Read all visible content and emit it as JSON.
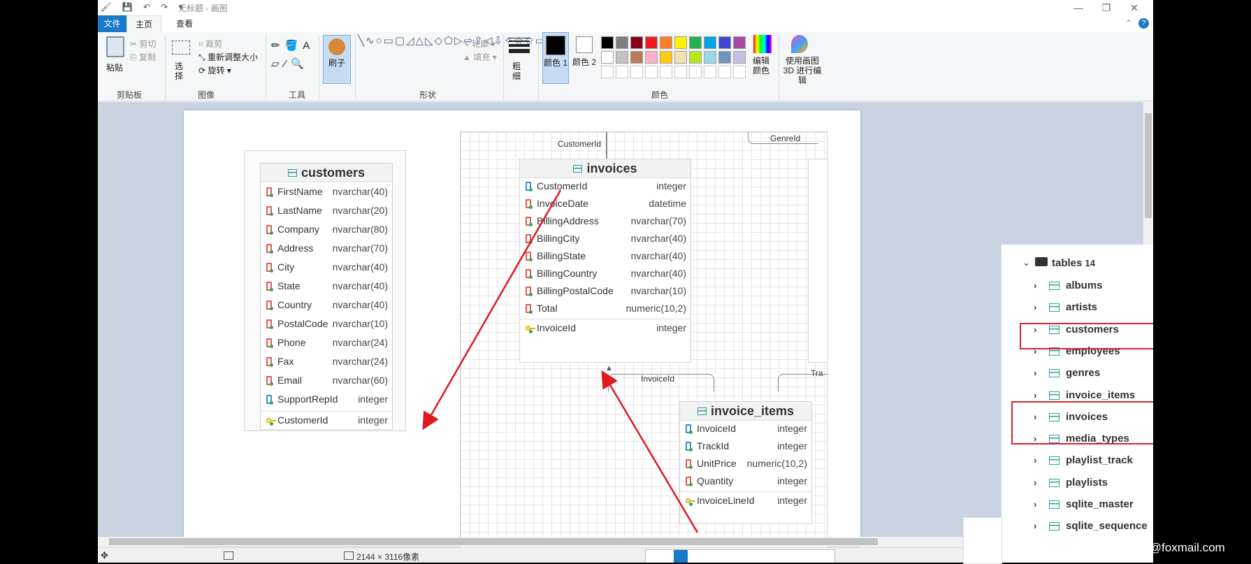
{
  "window": {
    "title": "无标题 - 画图",
    "controls": [
      "—",
      "❐",
      "✕"
    ]
  },
  "tabs": {
    "file": "文件",
    "home": "主页",
    "view": "查看"
  },
  "ribbon": {
    "clipboard": {
      "paste": "粘贴",
      "cut": "剪切",
      "copy": "复制",
      "label": "剪贴板"
    },
    "image": {
      "select": "选择",
      "crop": "裁剪",
      "resize": "重新调整大小",
      "rotate": "旋转",
      "label": "图像"
    },
    "tools": {
      "label": "工具"
    },
    "brush": {
      "label": "刷子"
    },
    "shapes": {
      "outline": "轮廓",
      "fill": "填充",
      "label": "形状"
    },
    "size": {
      "label": "粗细"
    },
    "color1": "颜色 1",
    "color2": "颜色 2",
    "edit_colors": "编辑颜色",
    "paint3d": "使用画图 3D 进行编辑",
    "colors_label": "颜色",
    "palette": [
      "#000000",
      "#7f7f7f",
      "#880015",
      "#ed1c24",
      "#ff7f27",
      "#fff200",
      "#22b14c",
      "#00a2e8",
      "#3f48cc",
      "#a349a4",
      "#ffffff",
      "#c3c3c3",
      "#b97a57",
      "#ffaec9",
      "#ffc90e",
      "#efe4b0",
      "#b5e61d",
      "#99d9ea",
      "#7092be",
      "#c8bfe7"
    ]
  },
  "diagram": {
    "customers": {
      "title": "customers",
      "rows": [
        {
          "name": "FirstName",
          "type": "nvarchar(40)",
          "icon": "column-icon"
        },
        {
          "name": "LastName",
          "type": "nvarchar(20)",
          "icon": "column-icon"
        },
        {
          "name": "Company",
          "type": "nvarchar(80)",
          "icon": "column-icon"
        },
        {
          "name": "Address",
          "type": "nvarchar(70)",
          "icon": "column-icon"
        },
        {
          "name": "City",
          "type": "nvarchar(40)",
          "icon": "column-icon"
        },
        {
          "name": "State",
          "type": "nvarchar(40)",
          "icon": "column-icon"
        },
        {
          "name": "Country",
          "type": "nvarchar(40)",
          "icon": "column-icon"
        },
        {
          "name": "PostalCode",
          "type": "nvarchar(10)",
          "icon": "column-icon"
        },
        {
          "name": "Phone",
          "type": "nvarchar(24)",
          "icon": "column-icon"
        },
        {
          "name": "Fax",
          "type": "nvarchar(24)",
          "icon": "column-icon"
        },
        {
          "name": "Email",
          "type": "nvarchar(60)",
          "icon": "column-icon"
        },
        {
          "name": "SupportRepId",
          "type": "integer",
          "icon": "foreign-key-icon"
        },
        {
          "name": "CustomerId",
          "type": "integer",
          "icon": "primary-key-icon"
        }
      ]
    },
    "invoices": {
      "title": "invoices",
      "rel_label_top": "CustomerId",
      "rows": [
        {
          "name": "CustomerId",
          "type": "integer",
          "icon": "foreign-key-icon"
        },
        {
          "name": "InvoiceDate",
          "type": "datetime",
          "icon": "column-icon"
        },
        {
          "name": "BillingAddress",
          "type": "nvarchar(70)",
          "icon": "column-icon"
        },
        {
          "name": "BillingCity",
          "type": "nvarchar(40)",
          "icon": "column-icon"
        },
        {
          "name": "BillingState",
          "type": "nvarchar(40)",
          "icon": "column-icon"
        },
        {
          "name": "BillingCountry",
          "type": "nvarchar(40)",
          "icon": "column-icon"
        },
        {
          "name": "BillingPostalCode",
          "type": "nvarchar(10)",
          "icon": "column-icon"
        },
        {
          "name": "Total",
          "type": "numeric(10,2)",
          "icon": "column-icon"
        },
        {
          "name": "InvoiceId",
          "type": "integer",
          "icon": "primary-key-icon"
        }
      ]
    },
    "invoice_items": {
      "title": "invoice_items",
      "rel_label": "InvoiceId",
      "rows": [
        {
          "name": "InvoiceId",
          "type": "integer",
          "icon": "foreign-key-icon"
        },
        {
          "name": "TrackId",
          "type": "integer",
          "icon": "foreign-key-icon"
        },
        {
          "name": "UnitPrice",
          "type": "numeric(10,2)",
          "icon": "column-icon"
        },
        {
          "name": "Quantity",
          "type": "integer",
          "icon": "column-icon"
        },
        {
          "name": "InvoiceLineId",
          "type": "integer",
          "icon": "primary-key-icon"
        }
      ]
    },
    "genre_label": "GenreId",
    "track_label": "Tra"
  },
  "tree": {
    "root": "tables",
    "count": "14",
    "items": [
      "albums",
      "artists",
      "customers",
      "employees",
      "genres",
      "invoice_items",
      "invoices",
      "media_types",
      "playlist_track",
      "playlists",
      "sqlite_master",
      "sqlite_sequence"
    ]
  },
  "status": {
    "dimensions": "2144 × 3116像素"
  },
  "watermark": "CSDN @a.Yang@foxmail.com"
}
